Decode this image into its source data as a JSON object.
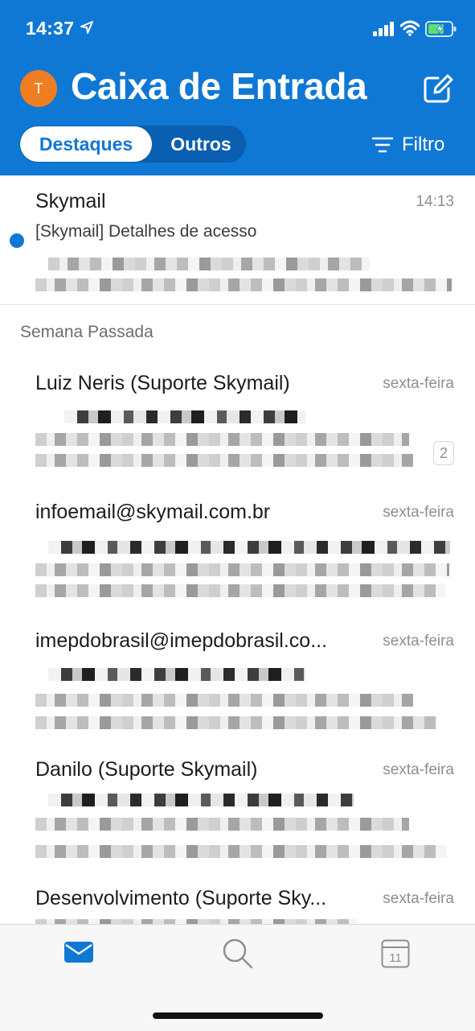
{
  "status_bar": {
    "time": "14:37",
    "icons": [
      "location-arrow-icon",
      "signal-icon",
      "wifi-icon",
      "battery-charging-icon"
    ]
  },
  "header": {
    "avatar_initial": "T",
    "title": "Caixa de Entrada",
    "tabs": [
      {
        "label": "Destaques",
        "active": true
      },
      {
        "label": "Outros",
        "active": false
      }
    ],
    "filter_label": "Filtro"
  },
  "mail_list": {
    "section_label": "Semana Passada",
    "items": [
      {
        "sender": "Skymail",
        "time": "14:13",
        "subject": "[Skymail] Detalhes de acesso",
        "unread": true
      },
      {
        "sender": "Luiz Neris (Suporte Skymail)",
        "time": "sexta-feira",
        "thread_count": "2"
      },
      {
        "sender": "infoemail@skymail.com.br",
        "time": "sexta-feira"
      },
      {
        "sender": "imepdobrasil@imepdobrasil.co...",
        "time": "sexta-feira"
      },
      {
        "sender": "Danilo (Suporte Skymail)",
        "time": "sexta-feira"
      },
      {
        "sender": "Desenvolvimento (Suporte Sky...",
        "time": "sexta-feira"
      }
    ]
  },
  "tab_bar": {
    "items": [
      {
        "icon": "mail-icon",
        "active": true
      },
      {
        "icon": "search-icon",
        "active": false
      },
      {
        "icon": "calendar-icon",
        "label": "11",
        "active": false
      }
    ]
  },
  "colors": {
    "brand_blue": "#0f78d4",
    "avatar_orange": "#ef7d22",
    "secondary_text": "#8e8e93"
  }
}
